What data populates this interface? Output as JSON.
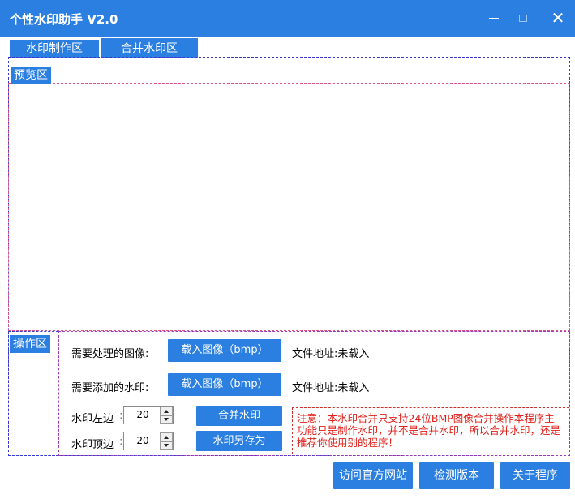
{
  "window": {
    "title": "个性水印助手 V2.0",
    "colors": {
      "accent": "#2b7fe0",
      "notice": "#e0201a"
    }
  },
  "tabs": [
    {
      "label": "水印制作区"
    },
    {
      "label": "合并水印区"
    }
  ],
  "preview": {
    "label": "预览区"
  },
  "operation": {
    "label": "操作区",
    "image_row": {
      "label": "需要处理的图像:",
      "button": "载入图像（bmp）",
      "file_label": "文件地址:",
      "file_value": "未载入"
    },
    "watermark_row": {
      "label": "需要添加的水印:",
      "button": "载入图像（bmp）",
      "file_label": "文件地址:",
      "file_value": "未载入"
    },
    "left_margin": {
      "label": "水印左边",
      "value": "20"
    },
    "top_margin": {
      "label": "水印顶边",
      "value": "20"
    },
    "merge_button": "合并水印",
    "save_as_button": "水印另存为",
    "notice": "注意：本水印合并只支持24位BMP图像合并操作本程序主功能只是制作水印，并不是合并水印，所以合并水印，还是推荐你使用别的程序！"
  },
  "footer": {
    "visit_site": "访问官方网站",
    "check_version": "检测版本",
    "about": "关于程序"
  }
}
